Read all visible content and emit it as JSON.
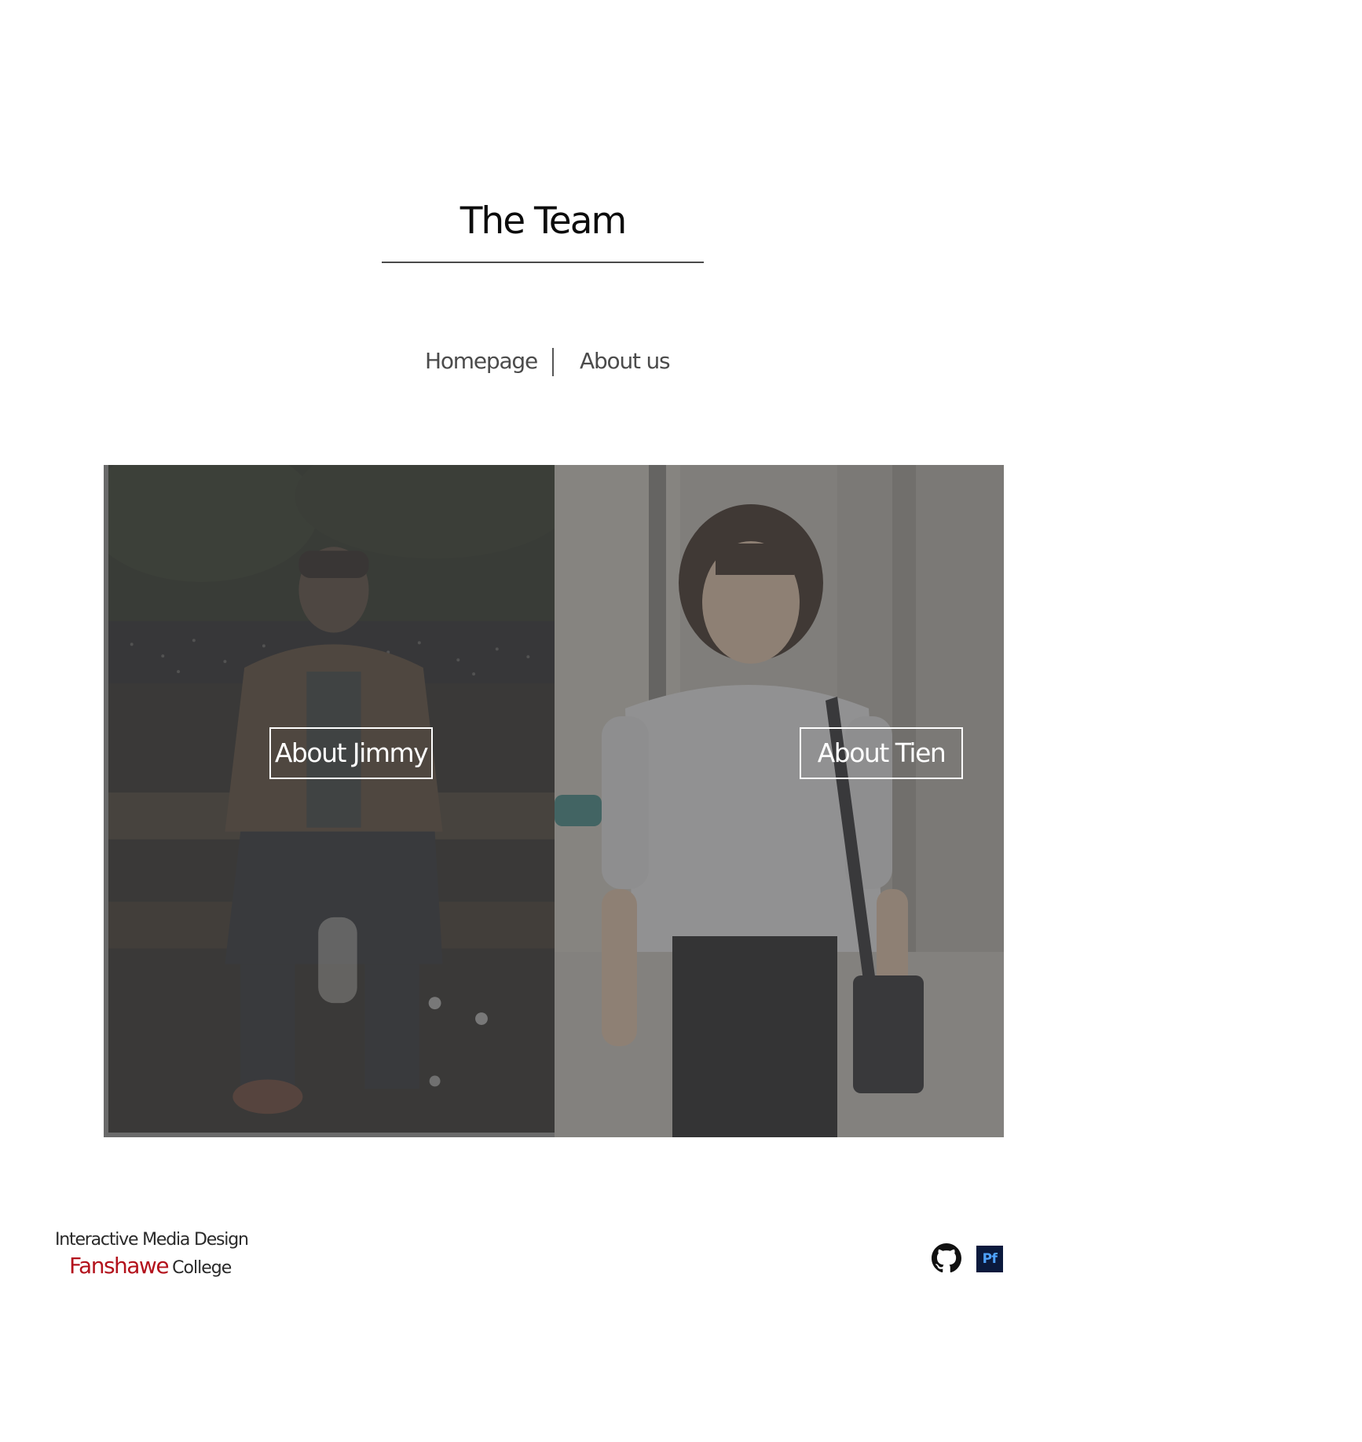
{
  "header": {
    "title": "The Team"
  },
  "nav": {
    "home_label": "Homepage",
    "separator": "|",
    "about_label": "About us"
  },
  "team": {
    "members": [
      {
        "name": "Jimmy",
        "button_label": "About Jimmy"
      },
      {
        "name": "Tien",
        "button_label": "About Tien"
      }
    ]
  },
  "footer": {
    "program": "Interactive Media Design",
    "school_name": "Fanshawe",
    "school_suffix": "College",
    "school_accent_color": "#b3121c",
    "social": [
      {
        "name": "github-icon"
      },
      {
        "name": "portfolio-icon",
        "label": "Pf"
      }
    ]
  }
}
